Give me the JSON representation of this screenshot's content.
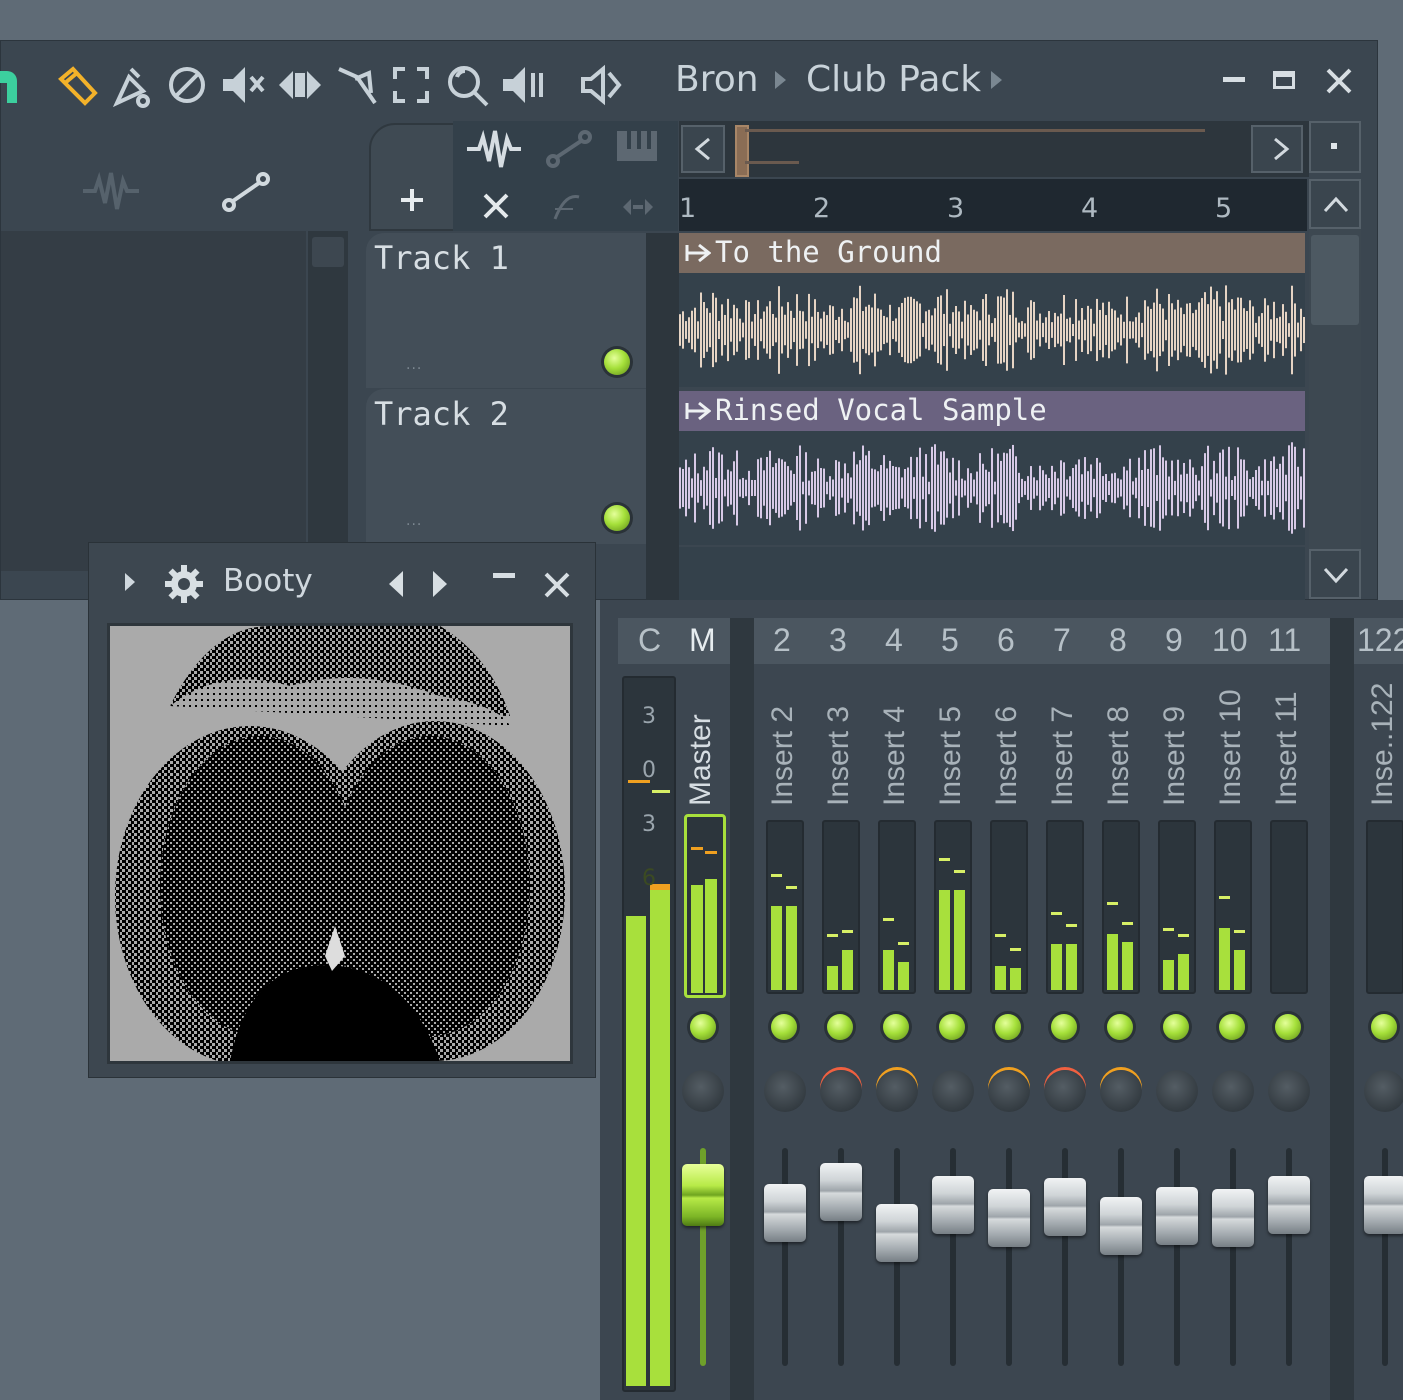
{
  "breadcrumb": {
    "item1": "Bron",
    "item2": "Club Pack"
  },
  "ruler": {
    "marks": [
      "1",
      "2",
      "3",
      "4",
      "5"
    ]
  },
  "tracks": [
    {
      "name": "Track 1",
      "dots": "...",
      "clip": "To the Ground",
      "clip_color": "#7a6a60",
      "wave_color": "#e6d4c4"
    },
    {
      "name": "Track 2",
      "dots": "...",
      "clip": "Rinsed Vocal Sample",
      "clip_color": "#6a6280",
      "wave_color": "#d7c9e6"
    }
  ],
  "plugin": {
    "title": "Booty"
  },
  "mixer": {
    "header": [
      "C",
      "M",
      "2",
      "3",
      "4",
      "5",
      "6",
      "7",
      "8",
      "9",
      "10",
      "11",
      "122"
    ],
    "master_label": "Master",
    "meter_scale": [
      "3",
      "0",
      "3",
      "6"
    ],
    "strips": [
      {
        "name": "Insert 2",
        "fader": 0.7
      },
      {
        "name": "Insert 3",
        "fader": 0.8
      },
      {
        "name": "Insert 4",
        "fader": 0.61
      },
      {
        "name": "Insert 5",
        "fader": 0.74
      },
      {
        "name": "Insert 6",
        "fader": 0.68
      },
      {
        "name": "Insert 7",
        "fader": 0.73
      },
      {
        "name": "Insert 8",
        "fader": 0.64
      },
      {
        "name": "Insert 9",
        "fader": 0.69
      },
      {
        "name": "Insert 10",
        "fader": 0.68
      },
      {
        "name": "Insert 11",
        "fader": 0.74
      },
      {
        "name": "Inse..122",
        "fader": 0.74
      }
    ]
  },
  "colors": {
    "accent_green": "#a8e03c",
    "peak_orange": "#f0a020"
  }
}
